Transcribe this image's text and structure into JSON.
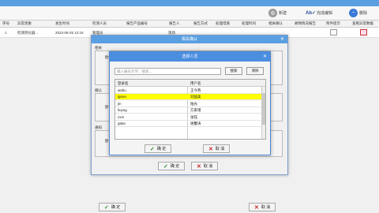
{
  "toolbar": {
    "buttons": [
      {
        "label": "新建",
        "icon": "gear-icon"
      },
      {
        "label": "完成编辑",
        "icon": "spellcheck-icon"
      },
      {
        "label": "删除",
        "icon": "minus-icon"
      }
    ]
  },
  "grid": {
    "headers": [
      "序号",
      "异常现象",
      "发生时间",
      "检测人员",
      "报告产品编号",
      "报告人",
      "报告方式",
      "处理措施",
      "处理时间",
      "相关确认",
      "故障情况报告",
      "附件提示",
      "查看异常数据"
    ],
    "rows": [
      {
        "no": "1",
        "phenomenon": "检测到仪器...",
        "time": "2022-06-25 12:18",
        "inspector": "管理员",
        "method": "现场"
      }
    ]
  },
  "outer_dialog": {
    "title": "相关确认",
    "section1": "相关",
    "section2": "确认",
    "section3": "通知",
    "field1": "欧",
    "field2": "欧",
    "field3": "欧",
    "ok_label": "确 定",
    "cancel_label": "取 消"
  },
  "inner_dialog": {
    "title": "选择人员",
    "search_placeholder": "输入编号文字，搜索...",
    "search_btn": "搜索",
    "clear_btn": "清除",
    "col_name": "登录名",
    "col_user": "用户名",
    "users": [
      {
        "login": "wahu",
        "name": "王今燕",
        "selected": false
      },
      {
        "login": "lgmei",
        "name": "刘国美",
        "selected": true
      },
      {
        "login": "jin",
        "name": "陆光",
        "selected": false
      },
      {
        "login": "liuyng",
        "name": "方家增",
        "selected": false
      },
      {
        "login": "zxm",
        "name": "张钰",
        "selected": false
      },
      {
        "login": "gttan",
        "name": "谢馨涛",
        "selected": false
      }
    ],
    "ok_label": "确 定",
    "cancel_label": "取 消"
  },
  "footer": {
    "ok_label": "确 定",
    "cancel_label": "取 消"
  }
}
